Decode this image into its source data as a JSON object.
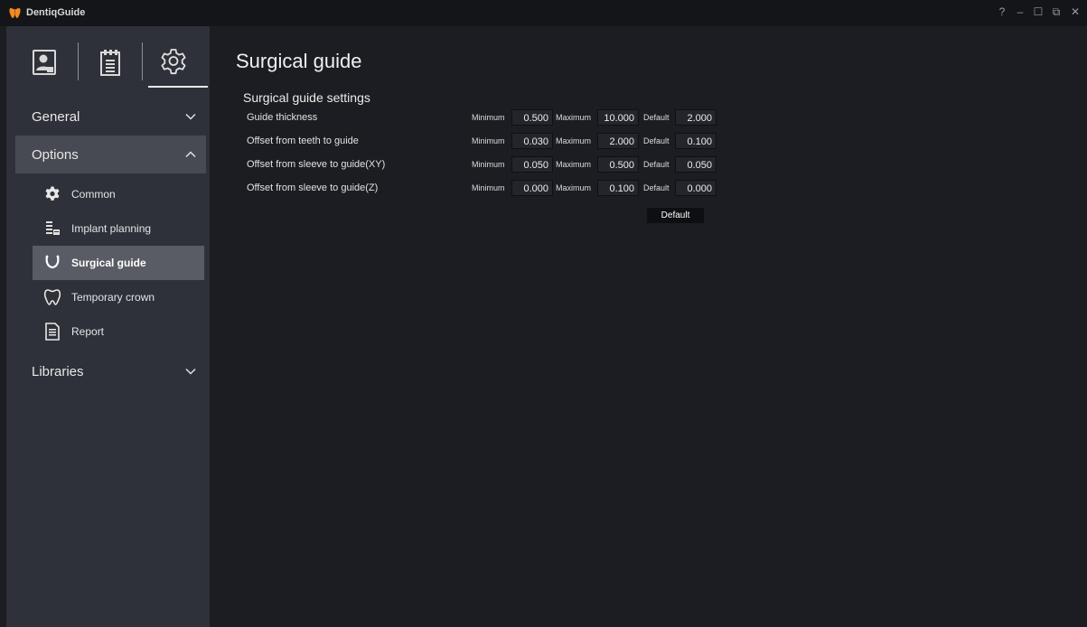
{
  "app": {
    "title": "DentiqGuide"
  },
  "window_controls": {
    "help": "?",
    "minimize": "–",
    "maximize": "☐",
    "restore": "⧉",
    "close": "✕"
  },
  "colors": {
    "accent": "#e8e8e8",
    "sidebar_bg": "#2e3139",
    "selected_bg": "#595c64",
    "main_bg": "#1c1d23"
  },
  "sidebar": {
    "top_icons": [
      {
        "name": "patient-icon"
      },
      {
        "name": "report-list-icon"
      },
      {
        "name": "settings-gear-icon",
        "active": true
      }
    ],
    "sections": [
      {
        "label": "General",
        "state": "collapsed"
      },
      {
        "label": "Options",
        "state": "expanded"
      },
      {
        "label": "Libraries",
        "state": "collapsed"
      }
    ],
    "option_items": [
      {
        "label": "Common",
        "icon": "gear-icon"
      },
      {
        "label": "Implant planning",
        "icon": "implant-icon"
      },
      {
        "label": "Surgical guide",
        "icon": "surgical-guide-icon",
        "selected": true
      },
      {
        "label": "Temporary crown",
        "icon": "tooth-icon"
      },
      {
        "label": "Report",
        "icon": "document-icon"
      }
    ]
  },
  "main": {
    "page_title": "Surgical guide",
    "section_title": "Surgical guide settings",
    "col_labels": {
      "min": "Minimum",
      "max": "Maximum",
      "def": "Default"
    },
    "rows": [
      {
        "label": "Guide thickness",
        "min": "0.500",
        "max": "10.000",
        "def": "2.000"
      },
      {
        "label": "Offset from teeth to guide",
        "min": "0.030",
        "max": "2.000",
        "def": "0.100"
      },
      {
        "label": "Offset from sleeve to guide(XY)",
        "min": "0.050",
        "max": "0.500",
        "def": "0.050"
      },
      {
        "label": "Offset from sleeve to guide(Z)",
        "min": "0.000",
        "max": "0.100",
        "def": "0.000"
      }
    ],
    "default_button": "Default"
  }
}
